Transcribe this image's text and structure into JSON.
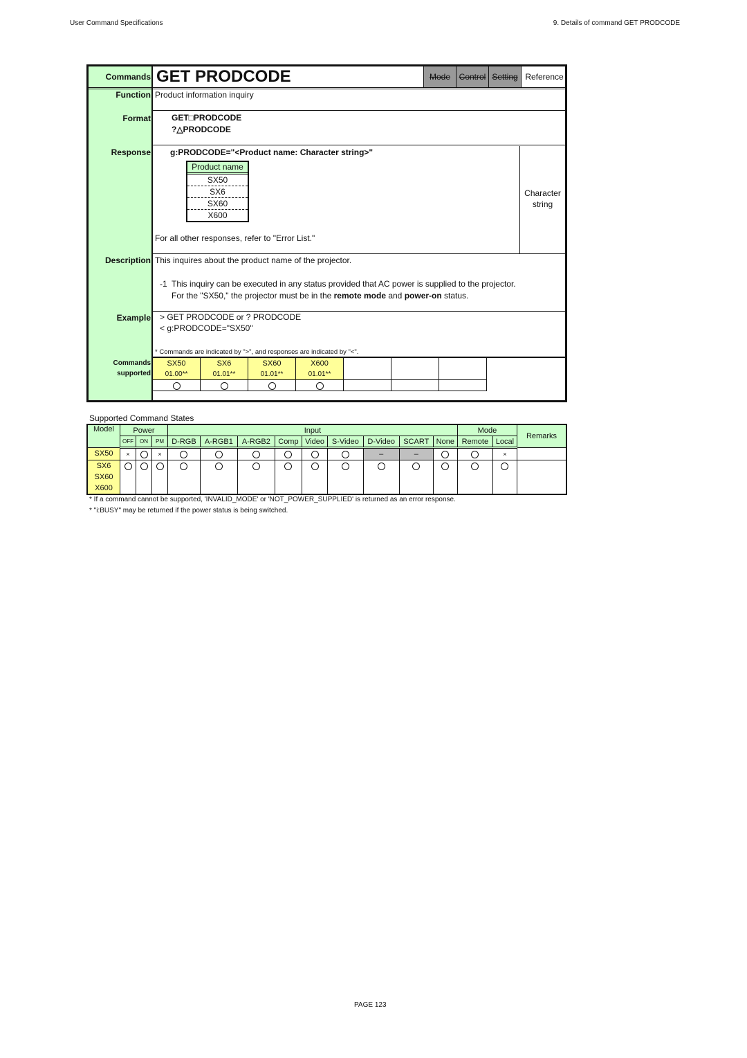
{
  "page_header": {
    "left": "User Command Specifications",
    "right": "9. Details of command  GET PRODCODE"
  },
  "command": {
    "label_commands": "Commands",
    "title": "GET PRODCODE",
    "mode_tags": [
      {
        "label": "Mode",
        "active": false,
        "color": "#999999"
      },
      {
        "label": "Control",
        "active": false,
        "color": "#999999"
      },
      {
        "label": "Setting",
        "active": false,
        "color": "#999999"
      },
      {
        "label": "Reference",
        "active": true,
        "color": "#ffffff"
      }
    ],
    "function_label": "Function",
    "function_text": "Product information inquiry",
    "format_label": "Format",
    "format_lines": [
      "GET□PRODCODE",
      "?△PRODCODE"
    ],
    "response_label": "Response",
    "response_format": "g:PRODCODE=\"<Product name: Character string>\"",
    "product_table": {
      "header": "Product name",
      "rows": [
        "SX50",
        "SX6",
        "SX60",
        "X600"
      ]
    },
    "response_type": "Character string",
    "response_other": "For all other responses, refer to \"Error List.\"",
    "description_label": "Description",
    "description_text": "This inquires about the product name of the projector.",
    "description_note_num": "-1",
    "description_note_line1": "This inquiry can be executed in any status provided that AC power is supplied to the projector.",
    "description_note_line2_pre": "For the \"SX50,\" the projector must be in the ",
    "description_note_bold1": "remote mode",
    "description_note_mid": " and ",
    "description_note_bold2": "power-on",
    "description_note_post": " status.",
    "example_label": "Example",
    "example_lines": [
      "> GET PRODCODE or ? PRODCODE",
      "< g:PRODCODE=\"SX50\""
    ],
    "example_note": "* Commands are indicated by \">\", and responses are indicated by \"<\".",
    "supported_label_1": "Commands",
    "supported_label_2": "supported",
    "supported_models": [
      {
        "model": "SX50",
        "version": "01.00**",
        "supported": "O"
      },
      {
        "model": "SX6",
        "version": "01.01**",
        "supported": "O"
      },
      {
        "model": "SX60",
        "version": "01.01**",
        "supported": "O"
      },
      {
        "model": "X600",
        "version": "01.01**",
        "supported": "O"
      },
      {
        "model": "",
        "version": "",
        "supported": ""
      },
      {
        "model": "",
        "version": "",
        "supported": ""
      },
      {
        "model": "",
        "version": "",
        "supported": ""
      }
    ]
  },
  "states": {
    "title": "Supported Command States",
    "headers": {
      "model": "Model",
      "power": "Power",
      "input": "Input",
      "mode": "Mode",
      "remarks": "Remarks",
      "power_sub": [
        "OFF",
        "ON",
        "PM"
      ],
      "input_sub": [
        "D-RGB",
        "A-RGB1",
        "A-RGB2",
        "Comp",
        "Video",
        "S-Video",
        "D-Video",
        "SCART",
        "None"
      ],
      "mode_sub": [
        "Remote",
        "Local"
      ]
    },
    "rows": [
      {
        "models": [
          "SX50"
        ],
        "values": [
          "×",
          "O",
          "×",
          "O",
          "O",
          "O",
          "O",
          "O",
          "O",
          "–",
          "–",
          "O",
          "O",
          "×"
        ],
        "remarks": ""
      },
      {
        "models": [
          "SX6",
          "SX60",
          "X600"
        ],
        "values": [
          "O",
          "O",
          "O",
          "O",
          "O",
          "O",
          "O",
          "O",
          "O",
          "O",
          "O",
          "O",
          "O",
          "O"
        ],
        "remarks": ""
      }
    ],
    "footnotes": [
      "* If a command cannot be supported, 'INVALID_MODE' or 'NOT_POWER_SUPPLIED' is returned as an error response.",
      "* \"i:BUSY\" may be returned if the power status is being switched."
    ]
  },
  "page_footer": "PAGE 123"
}
